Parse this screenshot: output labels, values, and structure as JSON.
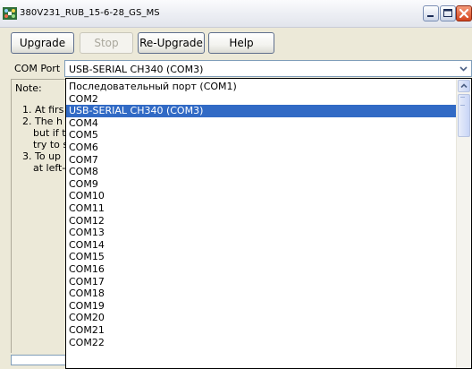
{
  "window": {
    "title": "380V231_RUB_15-6-28_GS_MS"
  },
  "toolbar": {
    "upgrade_label": "Upgrade",
    "stop_label": "Stop",
    "reupgrade_label": "Re-Upgrade",
    "help_label": "Help"
  },
  "com_port": {
    "label": "COM Port",
    "selected_value": "USB-SERIAL CH340 (COM3)",
    "options": [
      "Последовательный порт (COM1)",
      "COM2",
      "USB-SERIAL CH340 (COM3)",
      "COM4",
      "COM5",
      "COM6",
      "COM7",
      "COM8",
      "COM9",
      "COM10",
      "COM11",
      "COM12",
      "COM13",
      "COM14",
      "COM15",
      "COM16",
      "COM17",
      "COM18",
      "COM19",
      "COM20",
      "COM21",
      "COM22"
    ],
    "selected_index": 2
  },
  "note": {
    "label": "Note:",
    "lines": [
      "1. At firs",
      "2. The h",
      "but if t",
      "try to s",
      "3. To up",
      "at left-"
    ]
  },
  "colors": {
    "selection": "#316ac5",
    "background": "#ece9d8"
  }
}
